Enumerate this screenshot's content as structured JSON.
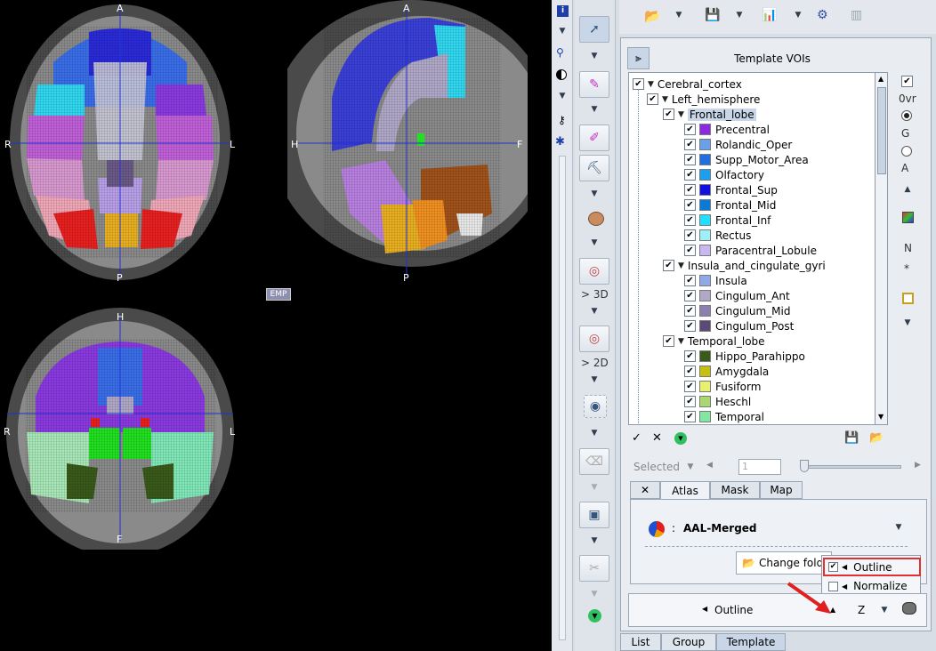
{
  "views": {
    "axial": {
      "top": "A",
      "bottom": "P",
      "left": "R",
      "right": "L"
    },
    "sagittal": {
      "top": "A",
      "bottom": "P",
      "left": "H",
      "right": "F"
    },
    "coronal": {
      "top": "H",
      "bottom": "F",
      "left": "R",
      "right": "L"
    },
    "emp_label": "EMP"
  },
  "left_toolbar": {
    "icons": [
      "info-icon",
      "pin-icon",
      "contrast-icon",
      "link-icon",
      "settings-icon"
    ]
  },
  "mid_toolbar": {
    "label_3d": "> 3D",
    "label_2d": "> 2D"
  },
  "top_toolbar": {
    "icons": [
      "open-icon",
      "save-icon",
      "chart-icon",
      "tool-icon",
      "template-icon"
    ]
  },
  "panel": {
    "title": "Template VOIs",
    "tree": [
      {
        "label": "Cerebral_cortex",
        "level": 0,
        "type": "folder"
      },
      {
        "label": "Left_hemisphere",
        "level": 1,
        "type": "folder"
      },
      {
        "label": "Frontal_lobe",
        "level": 2,
        "type": "folder",
        "selected": true
      },
      {
        "label": "Precentral",
        "level": 3,
        "color": "#8a2be2"
      },
      {
        "label": "Rolandic_Oper",
        "level": 3,
        "color": "#6aa0e8"
      },
      {
        "label": "Supp_Motor_Area",
        "level": 3,
        "color": "#1f6fe0"
      },
      {
        "label": "Olfactory",
        "level": 3,
        "color": "#1aa0f0"
      },
      {
        "label": "Frontal_Sup",
        "level": 3,
        "color": "#1010e0"
      },
      {
        "label": "Frontal_Mid",
        "level": 3,
        "color": "#0a7ad8"
      },
      {
        "label": "Frontal_Inf",
        "level": 3,
        "color": "#20e0ff"
      },
      {
        "label": "Rectus",
        "level": 3,
        "color": "#9ef0f8"
      },
      {
        "label": "Paracentral_Lobule",
        "level": 3,
        "color": "#c8b8f0"
      },
      {
        "label": "Insula_and_cingulate_gyri",
        "level": 2,
        "type": "folder"
      },
      {
        "label": "Insula",
        "level": 3,
        "color": "#8fa8e8"
      },
      {
        "label": "Cingulum_Ant",
        "level": 3,
        "color": "#b0a8c8"
      },
      {
        "label": "Cingulum_Mid",
        "level": 3,
        "color": "#8c80b0"
      },
      {
        "label": "Cingulum_Post",
        "level": 3,
        "color": "#5a4a78"
      },
      {
        "label": "Temporal_lobe",
        "level": 2,
        "type": "folder"
      },
      {
        "label": "Hippo_Parahippo",
        "level": 3,
        "color": "#3a5a1a"
      },
      {
        "label": "Amygdala",
        "level": 3,
        "color": "#c8c010"
      },
      {
        "label": "Fusiform",
        "level": 3,
        "color": "#e8f070"
      },
      {
        "label": "Heschl",
        "level": 3,
        "color": "#a8d870"
      },
      {
        "label": "Temporal",
        "level": 3,
        "color": "#80e8a0"
      }
    ],
    "side_labels": {
      "ovr": "0vr",
      "g": "G",
      "a": "A",
      "n": "N",
      "star": "*"
    },
    "selected_label": "Selected",
    "spinner_value": "1",
    "tabs": [
      "Atlas",
      "Mask",
      "Map"
    ],
    "close_tab": "✕",
    "atlas_separator": ":",
    "atlas_name": "AAL-Merged",
    "change_folder": "Change folde",
    "popup": [
      {
        "label": "Outline",
        "checked": true
      },
      {
        "label": "Normalize",
        "checked": false
      }
    ],
    "bottom_bar": {
      "outline": "Outline",
      "z": "Z"
    },
    "bottom_tabs": [
      "List",
      "Group",
      "Template"
    ]
  }
}
